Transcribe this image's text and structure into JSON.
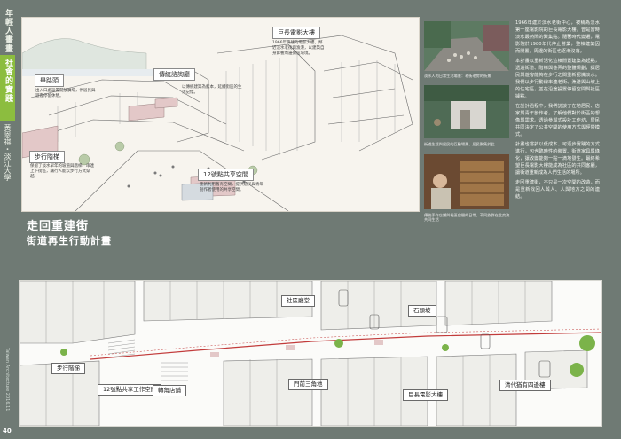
{
  "sidebar": {
    "series": "年輕人畫畫",
    "section": "社會的實踐",
    "author": "黃恩祺・淡江大學",
    "magazine": "Taiwan Architecture  2016.11",
    "page_number": "40"
  },
  "sketch": {
    "labels": {
      "theater": "巨長電影大樓",
      "hall": "傳統諮詢廳",
      "plaza": "畢路頭",
      "stairs": "步行階梯",
      "workspace": "12號點共享空間"
    },
    "notes": {
      "theater": "1966年興建的電影大樓，鄰近淡水老街與漁港，以建築自身影響周邊街區環境。",
      "hall": "以傳統建築為藍本，延續街區的生活記憶。",
      "plaza": "出入口處設置開放廣場，供居民與遊客停留休憩。",
      "stairs": "保留了淡水早年的坡道與階梯，串連上下街區，讓行人能以步行方式穿越。",
      "workspace": "重新利用舊有空間，提供居民與青年創作者使用的共享空間。"
    }
  },
  "photos": {
    "captions": [
      "淡水人的日常生活場景：老街老房的街景",
      "街道生活與居民的互動場景，居民聚集於此",
      "傳統手作店舖與社區空間的日常，不同族群在此交流共同生活"
    ]
  },
  "text": {
    "paragraphs": [
      "1966年建於淡水老街中心，被稱為淡水第一座電影院的巨長電影大樓，曾是當時淡水最熱鬧的聚集點。隨著時代變遷，電影院於1980年代停止營業，整棟建築因而閒置，周邊的街區也逐漸沒落。",
      "本計畫以重新活化這棟閒置建築為起點，透過街道、階梯與巷弄的整體規劃，讓居民與遊客能夠在步行之間重新認識淡水。我們以步行動線串連老街、漁港與山坡上的住宅區，並在沿途設置停留空間與社區據點。",
      "在設計過程中，我們訪談了在地居民、店家與青年創作者，了解他們對於街區的想像與需求。透過參與式設計工作坊，居民共同決定了公共空間的使用方式與經營模式。",
      "計畫也嘗試以低成本、可逐步實踐的方式進行，包含臨時性的裝置、街道家具與綠化，讓改變能夠一點一滴地發生。最終希望巨長電影大樓能成為社區的共同客廳，讓街道重新成為人們生活的場所。",
      "走回重建街，不只是一次空間的改造，而是重新找回人與人、人與地方之間的連結。"
    ]
  },
  "heading": {
    "title": "走回重建街",
    "subtitle": "街道再生行動計畫"
  },
  "plan": {
    "labels": {
      "community_hall": "社區廳堂",
      "stone_stairs": "石頭坡",
      "walk_stairs": "步行階梯",
      "workspace": "12號點共享工作空間",
      "shop": "轉角店舖",
      "triangle": "門前三角地",
      "theater_front": "巨長電影大樓",
      "plaza": "清代猶有四邊樓"
    }
  },
  "colors": {
    "background": "#6f7a74",
    "accent_green": "#8cbd3f",
    "route_red": "#c23b3b",
    "roof_pink": "#e3c8c8"
  }
}
